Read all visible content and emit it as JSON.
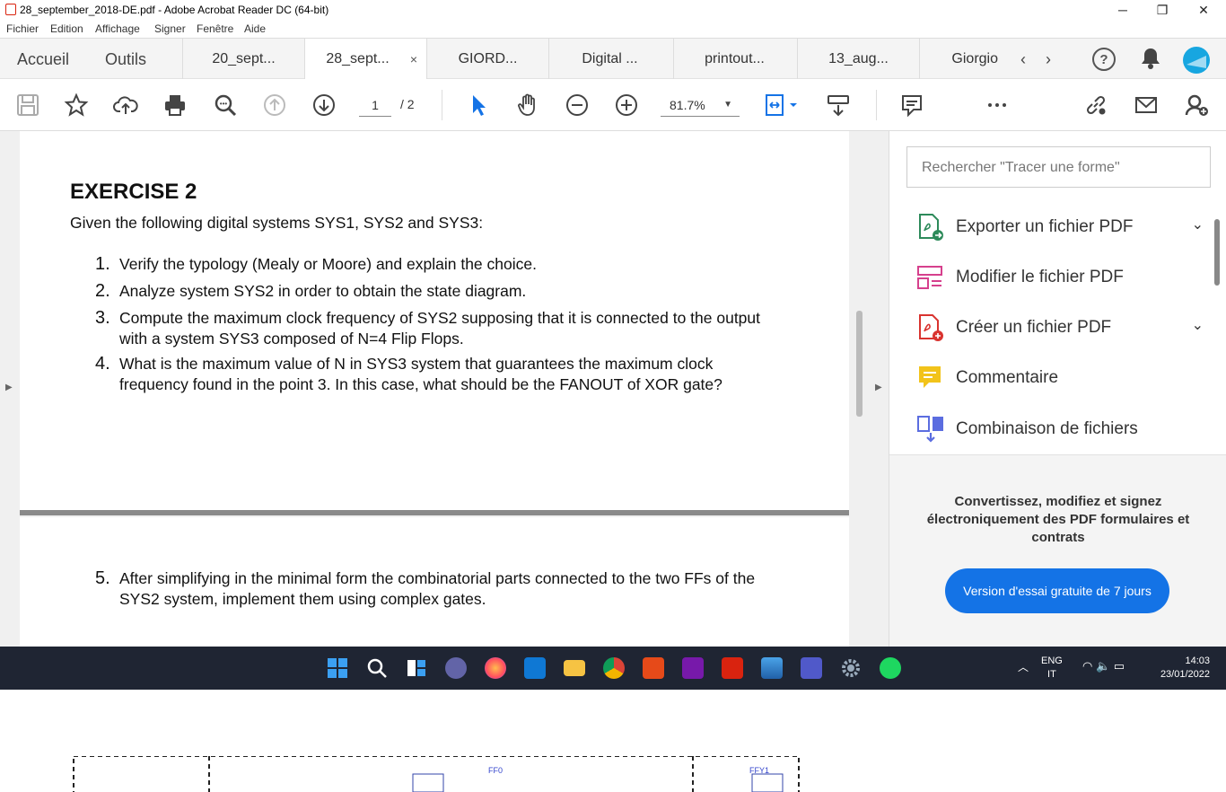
{
  "window": {
    "title": "28_september_2018-DE.pdf - Adobe Acrobat Reader DC (64-bit)",
    "minimize": "─",
    "restore": "❐",
    "close": "✕"
  },
  "menu": [
    "Fichier",
    "Edition",
    "Affichage",
    "Signer",
    "Fenêtre",
    "Aide"
  ],
  "nav": {
    "home": "Accueil",
    "tools": "Outils"
  },
  "tabs": [
    {
      "label": "20_sept..."
    },
    {
      "label": "28_sept...",
      "active": true,
      "close": "×"
    },
    {
      "label": "GIORD..."
    },
    {
      "label": "Digital ..."
    },
    {
      "label": "printout..."
    },
    {
      "label": "13_aug..."
    },
    {
      "label": "Giorgio"
    }
  ],
  "toolbar": {
    "page_current": "1",
    "page_total": "/ 2",
    "zoom": "81.7%"
  },
  "document": {
    "exercise_title": "EXERCISE 2",
    "intro": "Given the following digital systems SYS1, SYS2 and SYS3:",
    "items": [
      {
        "num": "1.",
        "lines": [
          "Verify the typology (Mealy or Moore) and explain the choice."
        ]
      },
      {
        "num": "2.",
        "lines": [
          "Analyze system SYS2 in order to obtain the state diagram."
        ]
      },
      {
        "num": "3.",
        "lines": [
          "Compute the maximum clock frequency of SYS2 supposing that it is connected to the output",
          "with a system SYS3 composed of N=4 Flip Flops."
        ]
      },
      {
        "num": "4.",
        "lines": [
          "What is the maximum value of N in SYS3 system that guarantees the maximum clock",
          "frequency found in the point 3. In this case, what should be the FANOUT of XOR gate?"
        ]
      }
    ],
    "item5": {
      "num": "5.",
      "lines": [
        "After simplifying in the minimal form the combinatorial parts connected to the two FFs of the",
        "SYS2 system, implement them using complex gates."
      ]
    },
    "diagram_labels": [
      "FF0",
      "FFY1"
    ]
  },
  "panel": {
    "search_placeholder": "Rechercher \"Tracer une forme\"",
    "tools": [
      {
        "label": "Exporter un fichier PDF",
        "icon": "export-pdf-icon",
        "color": "#2d8a5a",
        "chevron": true
      },
      {
        "label": "Modifier le fichier PDF",
        "icon": "edit-pdf-icon",
        "color": "#d6408d",
        "chevron": false
      },
      {
        "label": "Créer un fichier PDF",
        "icon": "create-pdf-icon",
        "color": "#d9332f",
        "chevron": true
      },
      {
        "label": "Commentaire",
        "icon": "comment-icon",
        "color": "#f2c31a",
        "chevron": false
      },
      {
        "label": "Combinaison de fichiers",
        "icon": "combine-files-icon",
        "color": "#5b6de0",
        "chevron": false
      }
    ],
    "promo_text": "Convertissez, modifiez et signez électroniquement des PDF formulaires et contrats",
    "promo_button": "Version d'essai gratuite de 7 jours"
  },
  "taskbar": {
    "lang1": "ENG",
    "lang2": "IT",
    "time": "14:03",
    "date": "23/01/2022"
  },
  "colors": {
    "accent": "#1473e6",
    "taskbar": "#1f2533"
  }
}
